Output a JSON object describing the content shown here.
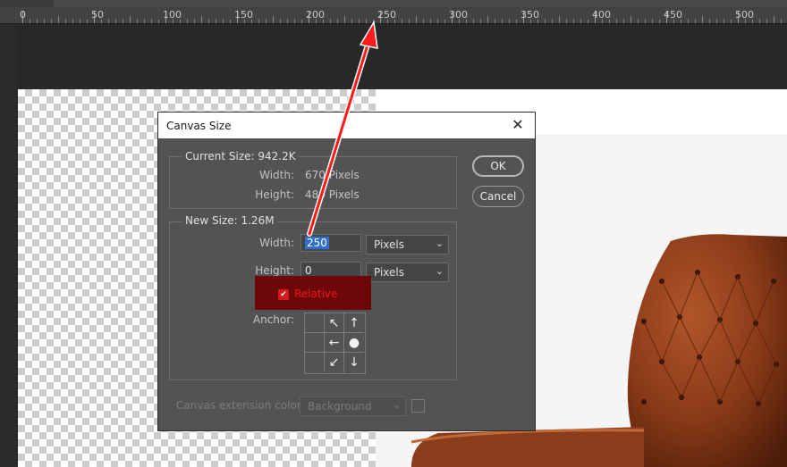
{
  "ruler": {
    "ticks": [
      "0",
      "50",
      "100",
      "150",
      "200",
      "250",
      "300",
      "350",
      "400",
      "450",
      "500"
    ]
  },
  "dialog": {
    "title": "Canvas Size",
    "close_glyph": "✕",
    "current_size": {
      "label": "Current Size: 942.2K",
      "width_label": "Width:",
      "width_value": "670 Pixels",
      "height_label": "Height:",
      "height_value": "480 Pixels"
    },
    "new_size": {
      "label": "New Size: 1.26M",
      "width_label": "Width:",
      "width_value": "250",
      "width_unit": "Pixels",
      "height_label": "Height:",
      "height_value": "0",
      "height_unit": "Pixels",
      "relative_label": "Relative",
      "relative_checked": true,
      "anchor_label": "Anchor:"
    },
    "ok_label": "OK",
    "cancel_label": "Cancel",
    "extension_label": "Canvas extension color:",
    "extension_value": "Background"
  },
  "colors": {
    "dialog_bg": "#535353",
    "highlight_box": "#6e0808",
    "relative_text": "#f01414",
    "annotation_arrow": "#ff1a1a",
    "selection": "#2f6fd0"
  }
}
